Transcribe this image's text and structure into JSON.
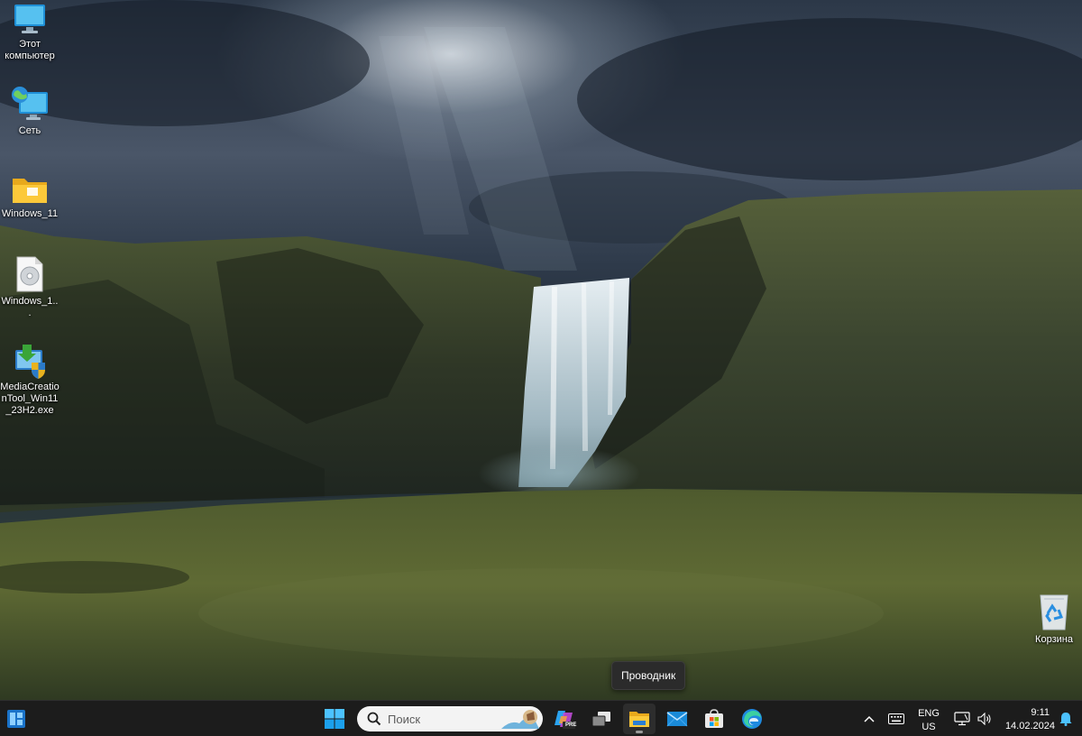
{
  "desktop": {
    "icons": [
      {
        "label": "Этот компьютер",
        "icon": "this-pc-icon"
      },
      {
        "label": "Сеть",
        "icon": "network-icon"
      },
      {
        "label": "Windows_11",
        "icon": "folder-icon"
      },
      {
        "label": "Windows_1...",
        "icon": "disc-image-file-icon"
      },
      {
        "label": "MediaCreationTool_Win11_23H2.exe",
        "icon": "media-creation-tool-icon"
      },
      {
        "label": "Корзина",
        "icon": "recycle-bin-icon"
      }
    ]
  },
  "tooltip": {
    "text": "Проводник"
  },
  "taskbar": {
    "widgets_icon": "widgets-icon",
    "start_icon": "windows-start-icon",
    "search": {
      "placeholder": "Поиск",
      "icon": "search-icon"
    },
    "apps": [
      {
        "name": "Copilot",
        "icon": "copilot-icon",
        "badge": "PRE"
      },
      {
        "name": "Task View",
        "icon": "task-view-icon"
      },
      {
        "name": "Проводник",
        "icon": "file-explorer-icon",
        "active": true
      },
      {
        "name": "Mail",
        "icon": "mail-icon"
      },
      {
        "name": "Microsoft Store",
        "icon": "store-icon"
      },
      {
        "name": "Edge",
        "icon": "edge-icon"
      }
    ],
    "tray": {
      "lang_line1": "ENG",
      "lang_line2": "US",
      "time": "9:11",
      "date": "14.02.2024"
    }
  },
  "colors": {
    "taskbar_bg": "#1c1c1c",
    "accent": "#0078d4",
    "tooltip_bg": "#2b2b2b"
  }
}
